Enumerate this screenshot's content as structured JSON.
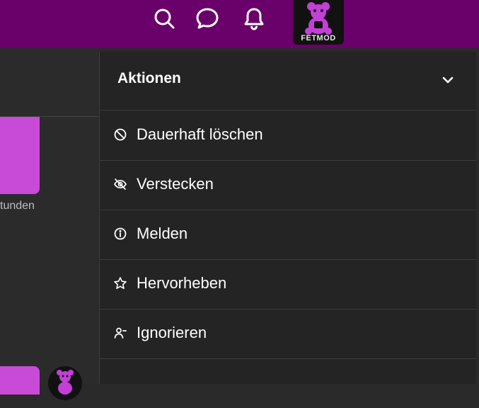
{
  "colors": {
    "topbar": "#6a006a",
    "accent_pink": "#c84bd8",
    "panel_bg": "#242424",
    "page_bg": "#2a2a2a",
    "divider": "#3d3d3d",
    "text": "#ffffff"
  },
  "topbar": {
    "icons": [
      "search-icon",
      "chat-icon",
      "bell-icon"
    ],
    "avatar_text": "FETMOD"
  },
  "left": {
    "timestamp_fragment": "tunden"
  },
  "actions_panel": {
    "title": "Aktionen",
    "items": [
      {
        "label": "Dauerhaft löschen",
        "icon": "ban-icon"
      },
      {
        "label": "Verstecken",
        "icon": "eye-off-icon"
      },
      {
        "label": "Melden",
        "icon": "info-icon"
      },
      {
        "label": "Hervorheben",
        "icon": "star-icon"
      },
      {
        "label": "Ignorieren",
        "icon": "user-minus-icon"
      }
    ]
  }
}
